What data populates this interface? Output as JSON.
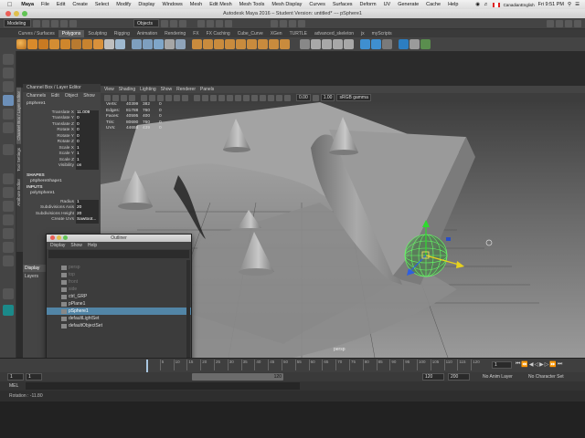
{
  "mac_menu": {
    "apple": "",
    "items": [
      "Maya",
      "File",
      "Edit",
      "Create",
      "Select",
      "Modify",
      "Display",
      "Windows",
      "Mesh",
      "Edit Mesh",
      "Mesh Tools",
      "Mesh Display",
      "Curves",
      "Surfaces",
      "Deform",
      "UV",
      "Generate",
      "Cache",
      "Help"
    ],
    "clock": "Fri 9:51 PM",
    "flag_label": "CanadianEnglish"
  },
  "window": {
    "title": "Autodesk Maya 2016 – Student Version: untitled*   ---   pSphere1"
  },
  "status_line": {
    "mode": "Modeling",
    "objects": "Objects"
  },
  "shelf": {
    "tabs": [
      "Curves / Surfaces",
      "Polygons",
      "Sculpting",
      "Rigging",
      "Animation",
      "Rendering",
      "FX",
      "FX Caching",
      "Cube_Curve",
      "XGen",
      "TURTLE",
      "advanced_skeleton",
      "jx",
      "myScripts"
    ],
    "active_tab": "Polygons"
  },
  "channel_box": {
    "header": "Channel Box / Layer Editor",
    "menus": [
      "Channels",
      "Edit",
      "Object",
      "Show"
    ],
    "object_name": "pSphere1",
    "channels": [
      {
        "label": "Translate X",
        "value": "11.009"
      },
      {
        "label": "Translate Y",
        "value": "0"
      },
      {
        "label": "Translate Z",
        "value": "0"
      },
      {
        "label": "Rotate X",
        "value": "0"
      },
      {
        "label": "Rotate Y",
        "value": "0"
      },
      {
        "label": "Rotate Z",
        "value": "0"
      },
      {
        "label": "Scale X",
        "value": "1"
      },
      {
        "label": "Scale Y",
        "value": "1"
      },
      {
        "label": "Scale Z",
        "value": "1"
      },
      {
        "label": "Visibility",
        "value": "on"
      }
    ],
    "shapes_label": "SHAPES",
    "shape_name": "pSphereShape1",
    "inputs_label": "INPUTS",
    "input_name": "polySphere1",
    "inputs": [
      {
        "label": "Radius",
        "value": "1"
      },
      {
        "label": "Subdivisions Axis",
        "value": "20"
      },
      {
        "label": "Subdivisions Height",
        "value": "20"
      },
      {
        "label": "Create UVs",
        "value": "Sawtoot..."
      }
    ]
  },
  "vertical_tabs": [
    "Channel Box / Layer Editor",
    "Tool Settings",
    "Attribute Editor"
  ],
  "layers": {
    "tab": "Display",
    "menu": "Layers"
  },
  "viewport": {
    "menus": [
      "View",
      "Shading",
      "Lighting",
      "Show",
      "Renderer",
      "Panels"
    ],
    "field_a": "0.00",
    "field_b": "1.00",
    "color_space": "sRGB gamma",
    "hud": [
      {
        "label": "Verts:",
        "a": "40399",
        "b": "382",
        "c": "0"
      },
      {
        "label": "Edges:",
        "a": "81788",
        "b": "760",
        "c": "0"
      },
      {
        "label": "Faces:",
        "a": "40595",
        "b": "400",
        "c": "0"
      },
      {
        "label": "Tris:",
        "a": "80690",
        "b": "760",
        "c": "0"
      },
      {
        "label": "UVs:",
        "a": "44658",
        "b": "439",
        "c": "0"
      }
    ],
    "camera_label": "persp"
  },
  "outliner": {
    "title": "Outliner",
    "menus": [
      "Display",
      "Show",
      "Help"
    ],
    "items": [
      {
        "label": "persp",
        "state": "dim"
      },
      {
        "label": "top",
        "state": "dim"
      },
      {
        "label": "front",
        "state": "dim"
      },
      {
        "label": "side",
        "state": "dim"
      },
      {
        "label": "ctrl_GRP",
        "state": "normal"
      },
      {
        "label": "pPlane1",
        "state": "normal"
      },
      {
        "label": "pSphere1",
        "state": "selected"
      },
      {
        "label": "defaultLightSet",
        "state": "normal"
      },
      {
        "label": "defaultObjectSet",
        "state": "normal"
      }
    ]
  },
  "timeline": {
    "ticks": [
      "5",
      "10",
      "15",
      "20",
      "25",
      "30",
      "35",
      "40",
      "45",
      "50",
      "55",
      "60",
      "65",
      "70",
      "75",
      "80",
      "85",
      "90",
      "95",
      "100",
      "105",
      "110",
      "115",
      "120"
    ],
    "current_frame": "1",
    "range_start": "1",
    "range_start_inner": "1",
    "range_end_inner": "120",
    "range_end": "120",
    "anim_end": "200",
    "anim_layer": "No Anim Layer",
    "character_set": "No Character Set"
  },
  "command_line": {
    "label": "MEL"
  },
  "help_line": {
    "text": "Rotation : -11.80"
  }
}
